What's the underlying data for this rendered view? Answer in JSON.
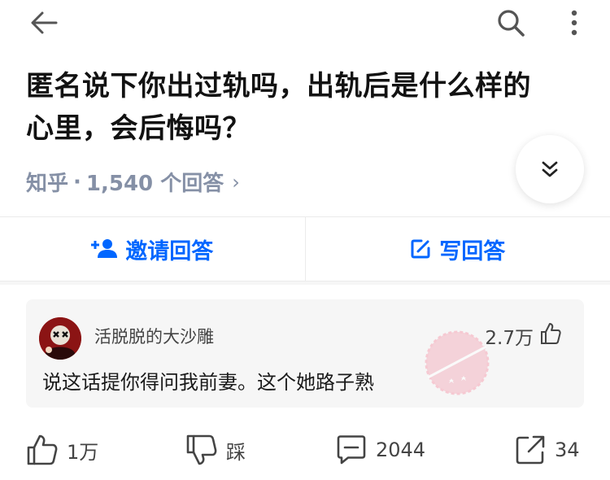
{
  "question": {
    "title_line1": "匿名说下你出过轨吗，出轨后是什么样的",
    "title_line2": "心里，会后悔吗？"
  },
  "meta": {
    "source": "知乎",
    "separator": "·",
    "answers": "1,540 个回答",
    "chevron": "›"
  },
  "actions": {
    "invite_label": "邀请回答",
    "write_label": "写回答"
  },
  "comment": {
    "username": "活脱脱的大沙雕",
    "likes": "2.7万",
    "text": "说这话提你得问我前妻。这个她路子熟"
  },
  "bottom": {
    "upvote": "1万",
    "downvote": "踩",
    "comments": "2044",
    "share": "34"
  },
  "colors": {
    "accent": "#0066ff",
    "meta": "#8590a6",
    "card": "#f6f6f6"
  }
}
